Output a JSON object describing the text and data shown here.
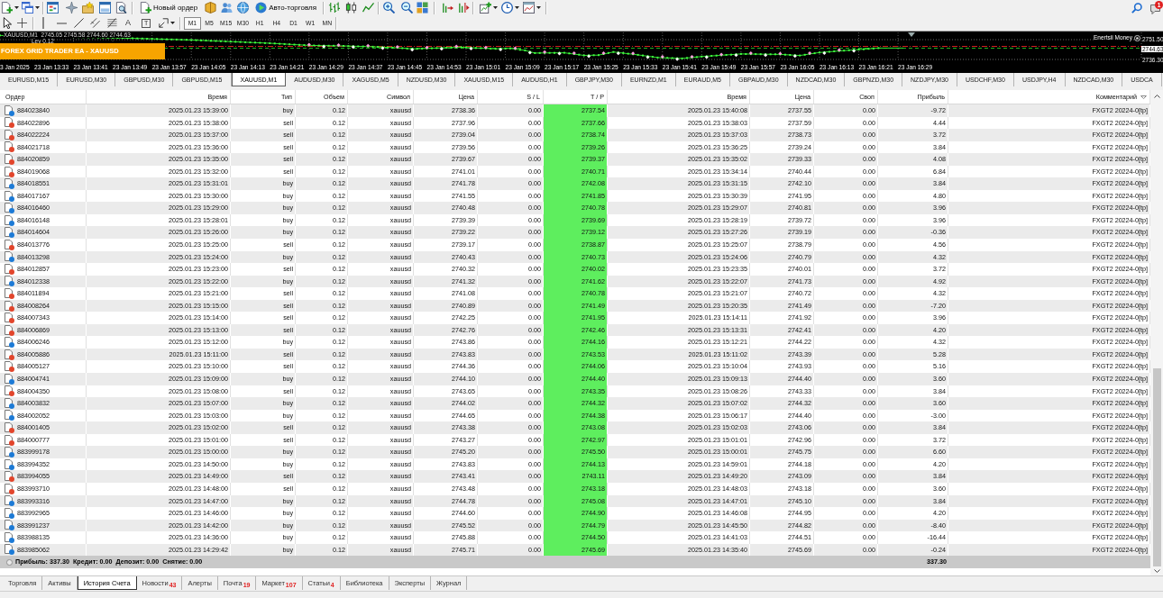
{
  "toolbar": {
    "new_order": "Новый ордер",
    "auto_trading": "Авто-торговля",
    "notification_count": "1"
  },
  "drawing_toolbar": {
    "text_tool": "A",
    "label_tool": "T",
    "periods": [
      {
        "label": "M1",
        "selected": true
      },
      {
        "label": "M5",
        "selected": false
      },
      {
        "label": "M15",
        "selected": false
      },
      {
        "label": "M30",
        "selected": false
      },
      {
        "label": "H1",
        "selected": false
      },
      {
        "label": "H4",
        "selected": false
      },
      {
        "label": "D1",
        "selected": false
      },
      {
        "label": "W1",
        "selected": false
      },
      {
        "label": "MN",
        "selected": false
      }
    ]
  },
  "chart": {
    "info": "XAUUSD,M1  2745.05 2745.58 2744.60 2744.63",
    "info_2": "Lev 0.12",
    "ea_label": "FOREX GRID TRADER EA - XAUUSD",
    "indicator": "Enertsii Money",
    "price_labels": [
      {
        "text": "2751.50",
        "current": false
      },
      {
        "text": "2744.63",
        "current": true
      },
      {
        "text": "2736.30",
        "current": false
      }
    ],
    "time_labels": [
      "3 Jan 2025",
      "23 Jan 13:33",
      "23 Jan 13:41",
      "23 Jan 13:49",
      "23 Jan 13:57",
      "23 Jan 14:05",
      "23 Jan 14:13",
      "23 Jan 14:21",
      "23 Jan 14:29",
      "23 Jan 14:37",
      "23 Jan 14:45",
      "23 Jan 14:53",
      "23 Jan 15:01",
      "23 Jan 15:09",
      "23 Jan 15:17",
      "23 Jan 15:25",
      "23 Jan 15:33",
      "23 Jan 15:41",
      "23 Jan 15:49",
      "23 Jan 15:57",
      "23 Jan 16:05",
      "23 Jan 16:13",
      "23 Jan 16:21",
      "23 Jan 16:29"
    ]
  },
  "chart_tabs": [
    {
      "label": "EURUSD,M15",
      "selected": false
    },
    {
      "label": "EURUSD,M30",
      "selected": false
    },
    {
      "label": "GBPUSD,M30",
      "selected": false
    },
    {
      "label": "GBPUSD,M15",
      "selected": false
    },
    {
      "label": "XAUUSD,M1",
      "selected": true
    },
    {
      "label": "AUDUSD,M30",
      "selected": false
    },
    {
      "label": "XAGUSD,M5",
      "selected": false
    },
    {
      "label": "NZDUSD,M30",
      "selected": false
    },
    {
      "label": "XAUUSD,M15",
      "selected": false
    },
    {
      "label": "AUDUSD,H1",
      "selected": false
    },
    {
      "label": "GBPJPY,M30",
      "selected": false
    },
    {
      "label": "EURNZD,M1",
      "selected": false
    },
    {
      "label": "EURAUD,M5",
      "selected": false
    },
    {
      "label": "GBPAUD,M30",
      "selected": false
    },
    {
      "label": "NZDCAD,M30",
      "selected": false
    },
    {
      "label": "GBPNZD,M30",
      "selected": false
    },
    {
      "label": "NZDJPY,M30",
      "selected": false
    },
    {
      "label": "USDCHF,M30",
      "selected": false
    },
    {
      "label": "USDJPY,H4",
      "selected": false
    },
    {
      "label": "NZDCAD,M30",
      "selected": false
    },
    {
      "label": "USDCA",
      "selected": false
    }
  ],
  "table": {
    "columns": [
      {
        "label": "Ордер",
        "sorted": false
      },
      {
        "label": "Время",
        "sorted": false
      },
      {
        "label": "Тип",
        "sorted": false
      },
      {
        "label": "Объем",
        "sorted": false
      },
      {
        "label": "Символ",
        "sorted": false
      },
      {
        "label": "Цена",
        "sorted": false
      },
      {
        "label": "S / L",
        "sorted": false
      },
      {
        "label": "T / P",
        "sorted": false
      },
      {
        "label": "Время",
        "sorted": false
      },
      {
        "label": "Цена",
        "sorted": false
      },
      {
        "label": "Своп",
        "sorted": false
      },
      {
        "label": "Прибыль",
        "sorted": false
      },
      {
        "label": "Комментарий",
        "sorted": true
      }
    ],
    "rows": [
      {
        "color": "#1c7ad6",
        "cells": [
          "884023840",
          "2025.01.23 15:39:00",
          "buy",
          "0.12",
          "xauusd",
          "2738.36",
          "0.00",
          "2737.54",
          "2025.01.23 15:40:08",
          "2737.55",
          "0.00",
          "-9.72",
          "FXGT2 20224-0[tp]"
        ]
      },
      {
        "color": "#e2452b",
        "cells": [
          "884022896",
          "2025.01.23 15:38:00",
          "sell",
          "0.12",
          "xauusd",
          "2737.96",
          "0.00",
          "2737.66",
          "2025.01.23 15:38:03",
          "2737.59",
          "0.00",
          "4.44",
          "FXGT2 20224-0[tp]"
        ]
      },
      {
        "color": "#e2452b",
        "cells": [
          "884022224",
          "2025.01.23 15:37:00",
          "sell",
          "0.12",
          "xauusd",
          "2739.04",
          "0.00",
          "2738.74",
          "2025.01.23 15:37:03",
          "2738.73",
          "0.00",
          "3.72",
          "FXGT2 20224-0[tp]"
        ]
      },
      {
        "color": "#e2452b",
        "cells": [
          "884021718",
          "2025.01.23 15:36:00",
          "sell",
          "0.12",
          "xauusd",
          "2739.56",
          "0.00",
          "2739.26",
          "2025.01.23 15:36:25",
          "2739.24",
          "0.00",
          "3.84",
          "FXGT2 20224-0[tp]"
        ]
      },
      {
        "color": "#e2452b",
        "cells": [
          "884020859",
          "2025.01.23 15:35:00",
          "sell",
          "0.12",
          "xauusd",
          "2739.67",
          "0.00",
          "2739.37",
          "2025.01.23 15:35:02",
          "2739.33",
          "0.00",
          "4.08",
          "FXGT2 20224-0[tp]"
        ]
      },
      {
        "color": "#e2452b",
        "cells": [
          "884019068",
          "2025.01.23 15:32:00",
          "sell",
          "0.12",
          "xauusd",
          "2741.01",
          "0.00",
          "2740.71",
          "2025.01.23 15:34:14",
          "2740.44",
          "0.00",
          "6.84",
          "FXGT2 20224-0[tp]"
        ]
      },
      {
        "color": "#1c7ad6",
        "cells": [
          "884018551",
          "2025.01.23 15:31:01",
          "buy",
          "0.12",
          "xauusd",
          "2741.78",
          "0.00",
          "2742.08",
          "2025.01.23 15:31:15",
          "2742.10",
          "0.00",
          "3.84",
          "FXGT2 20224-0[tp]"
        ]
      },
      {
        "color": "#1c7ad6",
        "cells": [
          "884017167",
          "2025.01.23 15:30:00",
          "buy",
          "0.12",
          "xauusd",
          "2741.55",
          "0.00",
          "2741.85",
          "2025.01.23 15:30:39",
          "2741.95",
          "0.00",
          "4.80",
          "FXGT2 20224-0[tp]"
        ]
      },
      {
        "color": "#1c7ad6",
        "cells": [
          "884016460",
          "2025.01.23 15:29:00",
          "buy",
          "0.12",
          "xauusd",
          "2740.48",
          "0.00",
          "2740.78",
          "2025.01.23 15:29:07",
          "2740.81",
          "0.00",
          "3.96",
          "FXGT2 20224-0[tp]"
        ]
      },
      {
        "color": "#1c7ad6",
        "cells": [
          "884016148",
          "2025.01.23 15:28:01",
          "buy",
          "0.12",
          "xauusd",
          "2739.39",
          "0.00",
          "2739.69",
          "2025.01.23 15:28:19",
          "2739.72",
          "0.00",
          "3.96",
          "FXGT2 20224-0[tp]"
        ]
      },
      {
        "color": "#1c7ad6",
        "cells": [
          "884014604",
          "2025.01.23 15:26:00",
          "buy",
          "0.12",
          "xauusd",
          "2739.22",
          "0.00",
          "2739.12",
          "2025.01.23 15:27:26",
          "2739.19",
          "0.00",
          "-0.36",
          "FXGT2 20224-0[tp]"
        ]
      },
      {
        "color": "#e2452b",
        "cells": [
          "884013776",
          "2025.01.23 15:25:00",
          "sell",
          "0.12",
          "xauusd",
          "2739.17",
          "0.00",
          "2738.87",
          "2025.01.23 15:25:07",
          "2738.79",
          "0.00",
          "4.56",
          "FXGT2 20224-0[tp]"
        ]
      },
      {
        "color": "#1c7ad6",
        "cells": [
          "884013298",
          "2025.01.23 15:24:00",
          "buy",
          "0.12",
          "xauusd",
          "2740.43",
          "0.00",
          "2740.73",
          "2025.01.23 15:24:06",
          "2740.79",
          "0.00",
          "4.32",
          "FXGT2 20224-0[tp]"
        ]
      },
      {
        "color": "#e2452b",
        "cells": [
          "884012857",
          "2025.01.23 15:23:00",
          "sell",
          "0.12",
          "xauusd",
          "2740.32",
          "0.00",
          "2740.02",
          "2025.01.23 15:23:35",
          "2740.01",
          "0.00",
          "3.72",
          "FXGT2 20224-0[tp]"
        ]
      },
      {
        "color": "#1c7ad6",
        "cells": [
          "884012338",
          "2025.01.23 15:22:00",
          "buy",
          "0.12",
          "xauusd",
          "2741.32",
          "0.00",
          "2741.62",
          "2025.01.23 15:22:07",
          "2741.73",
          "0.00",
          "4.92",
          "FXGT2 20224-0[tp]"
        ]
      },
      {
        "color": "#e2452b",
        "cells": [
          "884011894",
          "2025.01.23 15:21:00",
          "sell",
          "0.12",
          "xauusd",
          "2741.08",
          "0.00",
          "2740.78",
          "2025.01.23 15:21:07",
          "2740.72",
          "0.00",
          "4.32",
          "FXGT2 20224-0[tp]"
        ]
      },
      {
        "color": "#e2452b",
        "cells": [
          "884008264",
          "2025.01.23 15:15:00",
          "sell",
          "0.12",
          "xauusd",
          "2740.89",
          "0.00",
          "2741.49",
          "2025.01.23 15:20:35",
          "2741.49",
          "0.00",
          "-7.20",
          "FXGT2 20224-0[tp]"
        ]
      },
      {
        "color": "#e2452b",
        "cells": [
          "884007343",
          "2025.01.23 15:14:00",
          "sell",
          "0.12",
          "xauusd",
          "2742.25",
          "0.00",
          "2741.95",
          "2025.01.23 15:14:11",
          "2741.92",
          "0.00",
          "3.96",
          "FXGT2 20224-0[tp]"
        ]
      },
      {
        "color": "#e2452b",
        "cells": [
          "884006869",
          "2025.01.23 15:13:00",
          "sell",
          "0.12",
          "xauusd",
          "2742.76",
          "0.00",
          "2742.46",
          "2025.01.23 15:13:31",
          "2742.41",
          "0.00",
          "4.20",
          "FXGT2 20224-0[tp]"
        ]
      },
      {
        "color": "#1c7ad6",
        "cells": [
          "884006246",
          "2025.01.23 15:12:00",
          "buy",
          "0.12",
          "xauusd",
          "2743.86",
          "0.00",
          "2744.16",
          "2025.01.23 15:12:21",
          "2744.22",
          "0.00",
          "4.32",
          "FXGT2 20224-0[tp]"
        ]
      },
      {
        "color": "#e2452b",
        "cells": [
          "884005886",
          "2025.01.23 15:11:00",
          "sell",
          "0.12",
          "xauusd",
          "2743.83",
          "0.00",
          "2743.53",
          "2025.01.23 15:11:02",
          "2743.39",
          "0.00",
          "5.28",
          "FXGT2 20224-0[tp]"
        ]
      },
      {
        "color": "#e2452b",
        "cells": [
          "884005127",
          "2025.01.23 15:10:00",
          "sell",
          "0.12",
          "xauusd",
          "2744.36",
          "0.00",
          "2744.06",
          "2025.01.23 15:10:04",
          "2743.93",
          "0.00",
          "5.16",
          "FXGT2 20224-0[tp]"
        ]
      },
      {
        "color": "#1c7ad6",
        "cells": [
          "884004741",
          "2025.01.23 15:09:00",
          "buy",
          "0.12",
          "xauusd",
          "2744.10",
          "0.00",
          "2744.40",
          "2025.01.23 15:09:13",
          "2744.40",
          "0.00",
          "3.60",
          "FXGT2 20224-0[tp]"
        ]
      },
      {
        "color": "#e2452b",
        "cells": [
          "884004350",
          "2025.01.23 15:08:00",
          "sell",
          "0.12",
          "xauusd",
          "2743.65",
          "0.00",
          "2743.35",
          "2025.01.23 15:08:26",
          "2743.33",
          "0.00",
          "3.84",
          "FXGT2 20224-0[tp]"
        ]
      },
      {
        "color": "#1c7ad6",
        "cells": [
          "884003832",
          "2025.01.23 15:07:00",
          "buy",
          "0.12",
          "xauusd",
          "2744.02",
          "0.00",
          "2744.32",
          "2025.01.23 15:07:02",
          "2744.32",
          "0.00",
          "3.60",
          "FXGT2 20224-0[tp]"
        ]
      },
      {
        "color": "#1c7ad6",
        "cells": [
          "884002052",
          "2025.01.23 15:03:00",
          "buy",
          "0.12",
          "xauusd",
          "2744.65",
          "0.00",
          "2744.38",
          "2025.01.23 15:06:17",
          "2744.40",
          "0.00",
          "-3.00",
          "FXGT2 20224-0[tp]"
        ]
      },
      {
        "color": "#e2452b",
        "cells": [
          "884001405",
          "2025.01.23 15:02:00",
          "sell",
          "0.12",
          "xauusd",
          "2743.38",
          "0.00",
          "2743.08",
          "2025.01.23 15:02:03",
          "2743.06",
          "0.00",
          "3.84",
          "FXGT2 20224-0[tp]"
        ]
      },
      {
        "color": "#e2452b",
        "cells": [
          "884000777",
          "2025.01.23 15:01:00",
          "sell",
          "0.12",
          "xauusd",
          "2743.27",
          "0.00",
          "2742.97",
          "2025.01.23 15:01:01",
          "2742.96",
          "0.00",
          "3.72",
          "FXGT2 20224-0[tp]"
        ]
      },
      {
        "color": "#1c7ad6",
        "cells": [
          "883999178",
          "2025.01.23 15:00:00",
          "buy",
          "0.12",
          "xauusd",
          "2745.20",
          "0.00",
          "2745.50",
          "2025.01.23 15:00:01",
          "2745.75",
          "0.00",
          "6.60",
          "FXGT2 20224-0[tp]"
        ]
      },
      {
        "color": "#1c7ad6",
        "cells": [
          "883994352",
          "2025.01.23 14:50:00",
          "buy",
          "0.12",
          "xauusd",
          "2743.83",
          "0.00",
          "2744.13",
          "2025.01.23 14:59:01",
          "2744.18",
          "0.00",
          "4.20",
          "FXGT2 20224-0[tp]"
        ]
      },
      {
        "color": "#e2452b",
        "cells": [
          "883994055",
          "2025.01.23 14:49:00",
          "sell",
          "0.12",
          "xauusd",
          "2743.41",
          "0.00",
          "2743.11",
          "2025.01.23 14:49:20",
          "2743.09",
          "0.00",
          "3.84",
          "FXGT2 20224-0[tp]"
        ]
      },
      {
        "color": "#e2452b",
        "cells": [
          "883993710",
          "2025.01.23 14:48:00",
          "sell",
          "0.12",
          "xauusd",
          "2743.48",
          "0.00",
          "2743.18",
          "2025.01.23 14:48:03",
          "2743.18",
          "0.00",
          "3.60",
          "FXGT2 20224-0[tp]"
        ]
      },
      {
        "color": "#1c7ad6",
        "cells": [
          "883993316",
          "2025.01.23 14:47:00",
          "buy",
          "0.12",
          "xauusd",
          "2744.78",
          "0.00",
          "2745.08",
          "2025.01.23 14:47:01",
          "2745.10",
          "0.00",
          "3.84",
          "FXGT2 20224-0[tp]"
        ]
      },
      {
        "color": "#1c7ad6",
        "cells": [
          "883992965",
          "2025.01.23 14:46:00",
          "buy",
          "0.12",
          "xauusd",
          "2744.60",
          "0.00",
          "2744.90",
          "2025.01.23 14:46:08",
          "2744.95",
          "0.00",
          "4.20",
          "FXGT2 20224-0[tp]"
        ]
      },
      {
        "color": "#1c7ad6",
        "cells": [
          "883991237",
          "2025.01.23 14:42:00",
          "buy",
          "0.12",
          "xauusd",
          "2745.52",
          "0.00",
          "2744.79",
          "2025.01.23 14:45:50",
          "2744.82",
          "0.00",
          "-8.40",
          "FXGT2 20224-0[tp]"
        ]
      },
      {
        "color": "#1c7ad6",
        "cells": [
          "883988135",
          "2025.01.23 14:36:00",
          "buy",
          "0.12",
          "xauusd",
          "2745.88",
          "0.00",
          "2744.50",
          "2025.01.23 14:41:03",
          "2744.51",
          "0.00",
          "-16.44",
          "FXGT2 20224-0[tp]"
        ]
      },
      {
        "color": "#1c7ad6",
        "cells": [
          "883985062",
          "2025.01.23 14:29:42",
          "buy",
          "0.12",
          "xauusd",
          "2745.71",
          "0.00",
          "2745.69",
          "2025.01.23 14:35:40",
          "2745.69",
          "0.00",
          "-0.24",
          "FXGT2 20224-0[tp]"
        ]
      }
    ],
    "summary": {
      "text": "Прибыль: 337.30  Кредит: 0.00  Депозит: 0.00  Снятие: 0.00",
      "profit": "337.30"
    }
  },
  "bottom_tabs": [
    {
      "label": "Торговля",
      "selected": false
    },
    {
      "label": "Активы",
      "selected": false
    },
    {
      "label": "История Счета",
      "selected": true
    },
    {
      "label": "Новости",
      "count": "43",
      "selected": false
    },
    {
      "label": "Алерты",
      "selected": false
    },
    {
      "label": "Почта",
      "count": "19",
      "selected": false
    },
    {
      "label": "Маркет",
      "count": "107",
      "selected": false
    },
    {
      "label": "Статьи",
      "count": "4",
      "selected": false
    },
    {
      "label": "Библиотека",
      "selected": false
    },
    {
      "label": "Эксперты",
      "selected": false
    },
    {
      "label": "Журнал",
      "selected": false
    }
  ]
}
